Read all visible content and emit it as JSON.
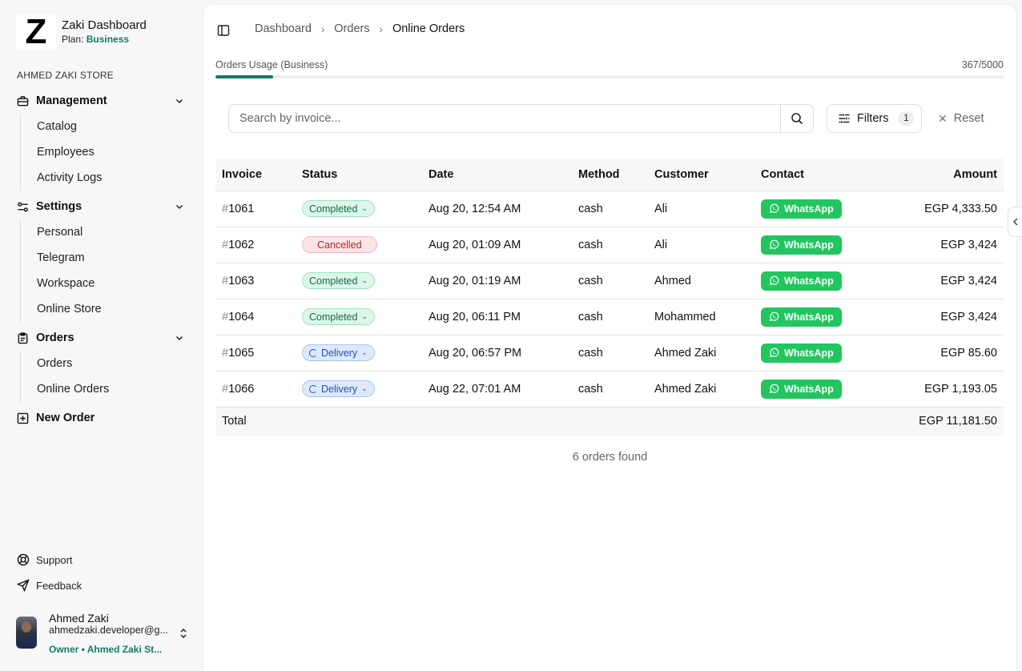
{
  "brand": {
    "logo_letter": "Z",
    "title": "Zaki Dashboard",
    "plan_prefix": "Plan:",
    "plan_name": "Business"
  },
  "sidebar": {
    "store_label": "AHMED ZAKI STORE",
    "groups": [
      {
        "label": "Management",
        "icon": "briefcase-icon",
        "items": [
          "Catalog",
          "Employees",
          "Activity Logs"
        ]
      },
      {
        "label": "Settings",
        "icon": "settings-sliders-icon",
        "items": [
          "Personal",
          "Telegram",
          "Workspace",
          "Online Store"
        ]
      },
      {
        "label": "Orders",
        "icon": "clipboard-icon",
        "items": [
          "Orders",
          "Online Orders"
        ]
      }
    ],
    "new_order": "New Order",
    "support": "Support",
    "feedback": "Feedback"
  },
  "user": {
    "name": "Ahmed Zaki",
    "email": "ahmedzaki.developer@g...",
    "role": "Owner • Ahmed Zaki St..."
  },
  "breadcrumb": [
    "Dashboard",
    "Orders",
    "Online Orders"
  ],
  "usage": {
    "label": "Orders Usage (Business)",
    "count": "367/5000",
    "fraction": 0.0734
  },
  "search": {
    "placeholder": "Search by invoice..."
  },
  "filters": {
    "label": "Filters",
    "count": "1"
  },
  "reset_label": "Reset",
  "table": {
    "headers": [
      "Invoice",
      "Status",
      "Date",
      "Method",
      "Customer",
      "Contact",
      "Amount"
    ],
    "rows": [
      {
        "invoice": "1061",
        "status": "Completed",
        "date": "Aug 20, 12:54 AM",
        "method": "cash",
        "customer": "Ali",
        "contact": "WhatsApp",
        "amount": "EGP 4,333.50"
      },
      {
        "invoice": "1062",
        "status": "Cancelled",
        "date": "Aug 20, 01:09 AM",
        "method": "cash",
        "customer": "Ali",
        "contact": "WhatsApp",
        "amount": "EGP 3,424"
      },
      {
        "invoice": "1063",
        "status": "Completed",
        "date": "Aug 20, 01:19 AM",
        "method": "cash",
        "customer": "Ahmed",
        "contact": "WhatsApp",
        "amount": "EGP 3,424"
      },
      {
        "invoice": "1064",
        "status": "Completed",
        "date": "Aug 20, 06:11 PM",
        "method": "cash",
        "customer": "Mohammed",
        "contact": "WhatsApp",
        "amount": "EGP 3,424"
      },
      {
        "invoice": "1065",
        "status": "Delivery",
        "date": "Aug 20, 06:57 PM",
        "method": "cash",
        "customer": "Ahmed Zaki",
        "contact": "WhatsApp",
        "amount": "EGP 85.60"
      },
      {
        "invoice": "1066",
        "status": "Delivery",
        "date": "Aug 22, 07:01 AM",
        "method": "cash",
        "customer": "Ahmed Zaki",
        "contact": "WhatsApp",
        "amount": "EGP 1,193.05"
      }
    ],
    "total_label": "Total",
    "total_amount": "EGP 11,181.50"
  },
  "found_text": "6 orders found",
  "colors": {
    "accent": "#0f7c66",
    "whatsapp": "#22c55e",
    "completed": "#166b44",
    "cancelled": "#b4232c",
    "delivery": "#1d4fb8"
  }
}
